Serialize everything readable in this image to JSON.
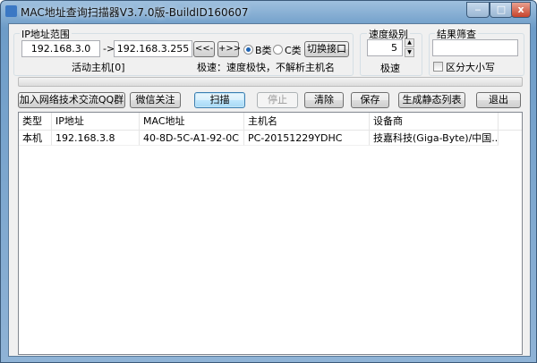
{
  "window": {
    "title": "MAC地址查询扫描器V3.7.0版-BuildID160607",
    "minimize": "‒",
    "maximize": "□",
    "close": "x"
  },
  "ip_range": {
    "label": "IP地址范围",
    "start": "192.168.3.0",
    "arrow": "->",
    "end": "192.168.3.255",
    "prev": "<<-",
    "next": "+>>",
    "class_b": "B类",
    "class_c": "C类",
    "selected_class": "B类",
    "switch_iface": "切换接口",
    "active_hosts": "活动主机[0]",
    "speed_desc": "极速：速度极快，不解析主机名"
  },
  "speed": {
    "label": "速度级别",
    "value": "5",
    "mode": "极速"
  },
  "filter": {
    "label": "结果筛查",
    "value": "",
    "case_sensitive": "区分大小写",
    "case_checked": false
  },
  "progress": 0,
  "buttons": {
    "join_qq": "加入网络技术交流QQ群",
    "wechat": "微信关注",
    "scan": "扫描",
    "stop": "停止",
    "clear": "清除",
    "save": "保存",
    "static_list": "生成静态列表",
    "exit": "退出"
  },
  "table": {
    "columns": [
      "类型",
      "IP地址",
      "MAC地址",
      "主机名",
      "设备商"
    ],
    "rows": [
      [
        "本机",
        "192.168.3.8",
        "40-8D-5C-A1-92-0C",
        "PC-20151229YDHC",
        "技嘉科技(Giga-Byte)/中国..."
      ]
    ]
  }
}
